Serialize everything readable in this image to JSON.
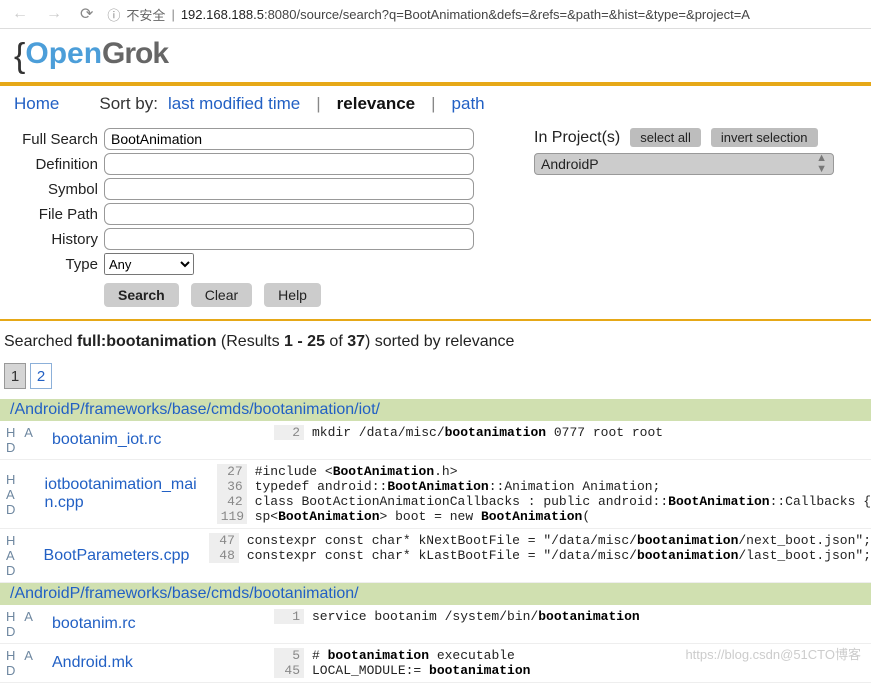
{
  "browser": {
    "warn_label": "不安全",
    "url_prefix": "192.168.188.5",
    "url_rest": ":8080/source/search?q=BootAnimation&defs=&refs=&path=&hist=&type=&project=A"
  },
  "logo": {
    "brace": "{",
    "open": "Open",
    "grok": "Grok"
  },
  "nav": {
    "home": "Home",
    "sort_by": "Sort by:",
    "lmt": "last modified time",
    "relevance": "relevance",
    "path": "path"
  },
  "form": {
    "labels": {
      "full": "Full Search",
      "def": "Definition",
      "sym": "Symbol",
      "fp": "File Path",
      "hist": "History",
      "type": "Type"
    },
    "full_value": "BootAnimation",
    "type_value": "Any",
    "buttons": {
      "search": "Search",
      "clear": "Clear",
      "help": "Help"
    }
  },
  "projects": {
    "title": "In Project(s)",
    "select_all": "select all",
    "invert": "invert selection",
    "selected": "AndroidP"
  },
  "status": {
    "prefix": "Searched ",
    "query": "full:bootanimation",
    "mid1": " (Results ",
    "range": "1 - 25",
    "mid2": " of ",
    "total": "37",
    "suffix": ") sorted by relevance"
  },
  "pager": [
    "1",
    "2"
  ],
  "had": "H A D",
  "groups": [
    {
      "dir": "/AndroidP/frameworks/base/cmds/bootanimation/iot/",
      "files": [
        {
          "name": "bootanim_iot.rc",
          "lines": [
            {
              "n": "2",
              "pre": "mkdir /data/misc/",
              "b": "bootanimation",
              "post": " 0777 root root"
            }
          ]
        },
        {
          "name": "iotbootanimation_main.cpp",
          "lines": [
            {
              "n": "27",
              "pre": "#include <",
              "b": "BootAnimation",
              "post": ".h>"
            },
            {
              "n": "36",
              "pre": "typedef android::",
              "b": "BootAnimation",
              "post": "::Animation Animation;"
            },
            {
              "n": "42",
              "pre": "class BootActionAnimationCallbacks : public android::",
              "b": "BootAnimation",
              "post": "::Callbacks {"
            },
            {
              "n": "119",
              "pre": "sp<",
              "b": "BootAnimation",
              "post": "> boot = new ",
              "b2": "BootAnimation",
              "post2": "("
            }
          ]
        },
        {
          "name": "BootParameters.cpp",
          "lines": [
            {
              "n": "47",
              "pre": "constexpr const char* kNextBootFile = \"/data/misc/",
              "b": "bootanimation",
              "post": "/next_boot.json\";"
            },
            {
              "n": "48",
              "pre": "constexpr const char* kLastBootFile = \"/data/misc/",
              "b": "bootanimation",
              "post": "/last_boot.json\";"
            }
          ]
        }
      ]
    },
    {
      "dir": "/AndroidP/frameworks/base/cmds/bootanimation/",
      "files": [
        {
          "name": "bootanim.rc",
          "lines": [
            {
              "n": "1",
              "pre": "service bootanim /system/bin/",
              "b": "bootanimation",
              "post": ""
            }
          ]
        },
        {
          "name": "Android.mk",
          "lines": [
            {
              "n": "5",
              "pre": "# ",
              "b": "bootanimation",
              "post": " executable"
            },
            {
              "n": "45",
              "pre": "LOCAL_MODULE:= ",
              "b": "bootanimation",
              "post": ""
            }
          ]
        }
      ]
    }
  ],
  "watermark": "https://blog.csdn@51CTO博客"
}
